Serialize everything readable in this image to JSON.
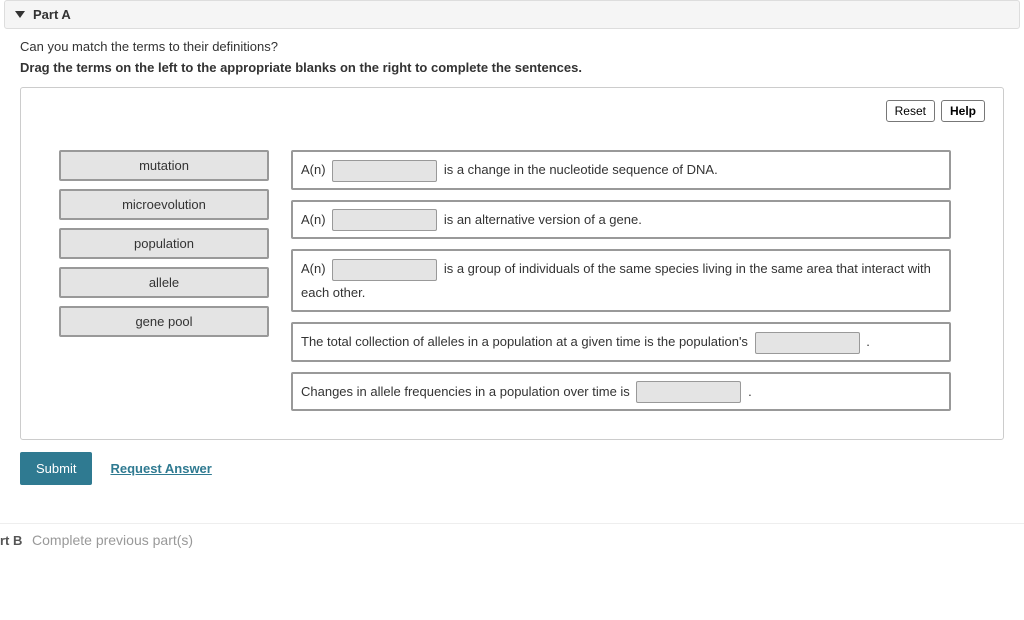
{
  "header": {
    "title": "Part A"
  },
  "question": "Can you match the terms to their definitions?",
  "instruction": "Drag the terms on the left to the appropriate blanks on the right to complete the sentences.",
  "buttons": {
    "reset": "Reset",
    "help": "Help",
    "submit": "Submit",
    "request": "Request Answer"
  },
  "terms": [
    "mutation",
    "microevolution",
    "population",
    "allele",
    "gene pool"
  ],
  "targets": {
    "t1": {
      "prefix": "A(n)",
      "suffix": "is a change in the nucleotide sequence of DNA."
    },
    "t2": {
      "prefix": "A(n)",
      "suffix": "is an alternative version of a gene."
    },
    "t3": {
      "prefix": "A(n)",
      "suffix": "is a group of individuals of the same species living in the same area that interact with each other."
    },
    "t4": {
      "prefix": "The total collection of alleles in a population at a given time is the population's",
      "suffix": "."
    },
    "t5": {
      "prefix": "Changes in allele frequencies in a population over time is",
      "suffix": "."
    }
  },
  "partB": {
    "label": "rt B",
    "message": "Complete previous part(s)"
  }
}
